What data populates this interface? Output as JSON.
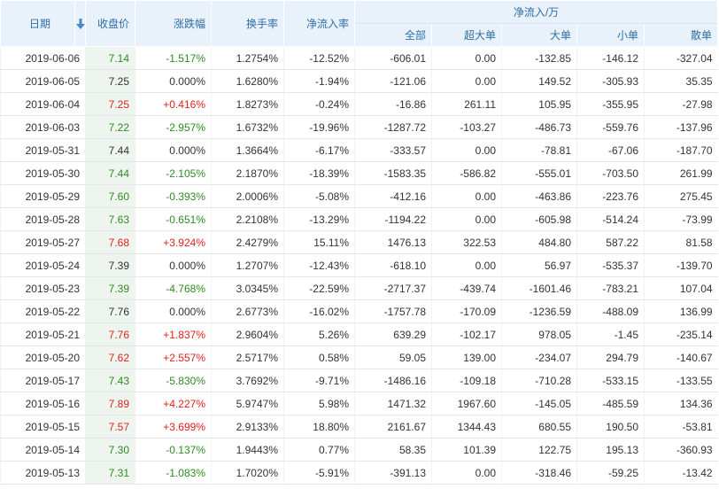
{
  "headers": {
    "date": "日期",
    "close": "收盘价",
    "change": "涨跌幅",
    "turnover": "换手率",
    "net_ratio": "净流入率",
    "group": "净流入/万",
    "all": "全部",
    "super_large": "超大单",
    "large": "大单",
    "small": "小单",
    "retail": "散单",
    "sort_icon": "sort-down-arrow-icon"
  },
  "colors": {
    "header_bg": "#e9f2fb",
    "header_text": "#2f6ea5",
    "up": "#e0221c",
    "down": "#2e8b23",
    "price_bg": "#eef5ee"
  },
  "rows": [
    {
      "date": "2019-06-06",
      "close": "7.14",
      "change": "-1.517%",
      "dir": "down",
      "turnover": "1.2754%",
      "net_ratio": "-12.52%",
      "all": "-606.01",
      "super": "0.00",
      "large": "-132.85",
      "small": "-146.12",
      "retail": "-327.04"
    },
    {
      "date": "2019-06-05",
      "close": "7.25",
      "change": "0.000%",
      "dir": "flat",
      "turnover": "1.6280%",
      "net_ratio": "-1.94%",
      "all": "-121.06",
      "super": "0.00",
      "large": "149.52",
      "small": "-305.93",
      "retail": "35.35"
    },
    {
      "date": "2019-06-04",
      "close": "7.25",
      "change": "+0.416%",
      "dir": "up",
      "turnover": "1.8273%",
      "net_ratio": "-0.24%",
      "all": "-16.86",
      "super": "261.11",
      "large": "105.95",
      "small": "-355.95",
      "retail": "-27.98"
    },
    {
      "date": "2019-06-03",
      "close": "7.22",
      "change": "-2.957%",
      "dir": "down",
      "turnover": "1.6732%",
      "net_ratio": "-19.96%",
      "all": "-1287.72",
      "super": "-103.27",
      "large": "-486.73",
      "small": "-559.76",
      "retail": "-137.96"
    },
    {
      "date": "2019-05-31",
      "close": "7.44",
      "change": "0.000%",
      "dir": "flat",
      "turnover": "1.3664%",
      "net_ratio": "-6.17%",
      "all": "-333.57",
      "super": "0.00",
      "large": "-78.81",
      "small": "-67.06",
      "retail": "-187.70"
    },
    {
      "date": "2019-05-30",
      "close": "7.44",
      "change": "-2.105%",
      "dir": "down",
      "turnover": "2.1870%",
      "net_ratio": "-18.39%",
      "all": "-1583.35",
      "super": "-586.82",
      "large": "-555.01",
      "small": "-703.50",
      "retail": "261.99"
    },
    {
      "date": "2019-05-29",
      "close": "7.60",
      "change": "-0.393%",
      "dir": "down",
      "turnover": "2.0006%",
      "net_ratio": "-5.08%",
      "all": "-412.16",
      "super": "0.00",
      "large": "-463.86",
      "small": "-223.76",
      "retail": "275.45"
    },
    {
      "date": "2019-05-28",
      "close": "7.63",
      "change": "-0.651%",
      "dir": "down",
      "turnover": "2.2108%",
      "net_ratio": "-13.29%",
      "all": "-1194.22",
      "super": "0.00",
      "large": "-605.98",
      "small": "-514.24",
      "retail": "-73.99"
    },
    {
      "date": "2019-05-27",
      "close": "7.68",
      "change": "+3.924%",
      "dir": "up",
      "turnover": "2.4279%",
      "net_ratio": "15.11%",
      "all": "1476.13",
      "super": "322.53",
      "large": "484.80",
      "small": "587.22",
      "retail": "81.58"
    },
    {
      "date": "2019-05-24",
      "close": "7.39",
      "change": "0.000%",
      "dir": "flat",
      "turnover": "1.2707%",
      "net_ratio": "-12.43%",
      "all": "-618.10",
      "super": "0.00",
      "large": "56.97",
      "small": "-535.37",
      "retail": "-139.70"
    },
    {
      "date": "2019-05-23",
      "close": "7.39",
      "change": "-4.768%",
      "dir": "down",
      "turnover": "3.0345%",
      "net_ratio": "-22.59%",
      "all": "-2717.37",
      "super": "-439.74",
      "large": "-1601.46",
      "small": "-783.21",
      "retail": "107.04"
    },
    {
      "date": "2019-05-22",
      "close": "7.76",
      "change": "0.000%",
      "dir": "flat",
      "turnover": "2.6773%",
      "net_ratio": "-16.02%",
      "all": "-1757.78",
      "super": "-170.09",
      "large": "-1236.59",
      "small": "-488.09",
      "retail": "136.99"
    },
    {
      "date": "2019-05-21",
      "close": "7.76",
      "change": "+1.837%",
      "dir": "up",
      "turnover": "2.9604%",
      "net_ratio": "5.26%",
      "all": "639.29",
      "super": "-102.17",
      "large": "978.05",
      "small": "-1.45",
      "retail": "-235.14"
    },
    {
      "date": "2019-05-20",
      "close": "7.62",
      "change": "+2.557%",
      "dir": "up",
      "turnover": "2.5717%",
      "net_ratio": "0.58%",
      "all": "59.05",
      "super": "139.00",
      "large": "-234.07",
      "small": "294.79",
      "retail": "-140.67"
    },
    {
      "date": "2019-05-17",
      "close": "7.43",
      "change": "-5.830%",
      "dir": "down",
      "turnover": "3.7692%",
      "net_ratio": "-9.71%",
      "all": "-1486.16",
      "super": "-109.18",
      "large": "-710.28",
      "small": "-533.15",
      "retail": "-133.55"
    },
    {
      "date": "2019-05-16",
      "close": "7.89",
      "change": "+4.227%",
      "dir": "up",
      "turnover": "5.9747%",
      "net_ratio": "5.98%",
      "all": "1471.32",
      "super": "1967.60",
      "large": "-145.05",
      "small": "-485.59",
      "retail": "134.36"
    },
    {
      "date": "2019-05-15",
      "close": "7.57",
      "change": "+3.699%",
      "dir": "up",
      "turnover": "2.9133%",
      "net_ratio": "18.80%",
      "all": "2161.67",
      "super": "1344.43",
      "large": "680.55",
      "small": "190.50",
      "retail": "-53.81"
    },
    {
      "date": "2019-05-14",
      "close": "7.30",
      "change": "-0.137%",
      "dir": "down",
      "turnover": "1.9443%",
      "net_ratio": "0.77%",
      "all": "58.35",
      "super": "101.39",
      "large": "122.75",
      "small": "195.13",
      "retail": "-360.93"
    },
    {
      "date": "2019-05-13",
      "close": "7.31",
      "change": "-1.083%",
      "dir": "down",
      "turnover": "1.7020%",
      "net_ratio": "-5.91%",
      "all": "-391.13",
      "super": "0.00",
      "large": "-318.46",
      "small": "-59.25",
      "retail": "-13.42"
    }
  ]
}
